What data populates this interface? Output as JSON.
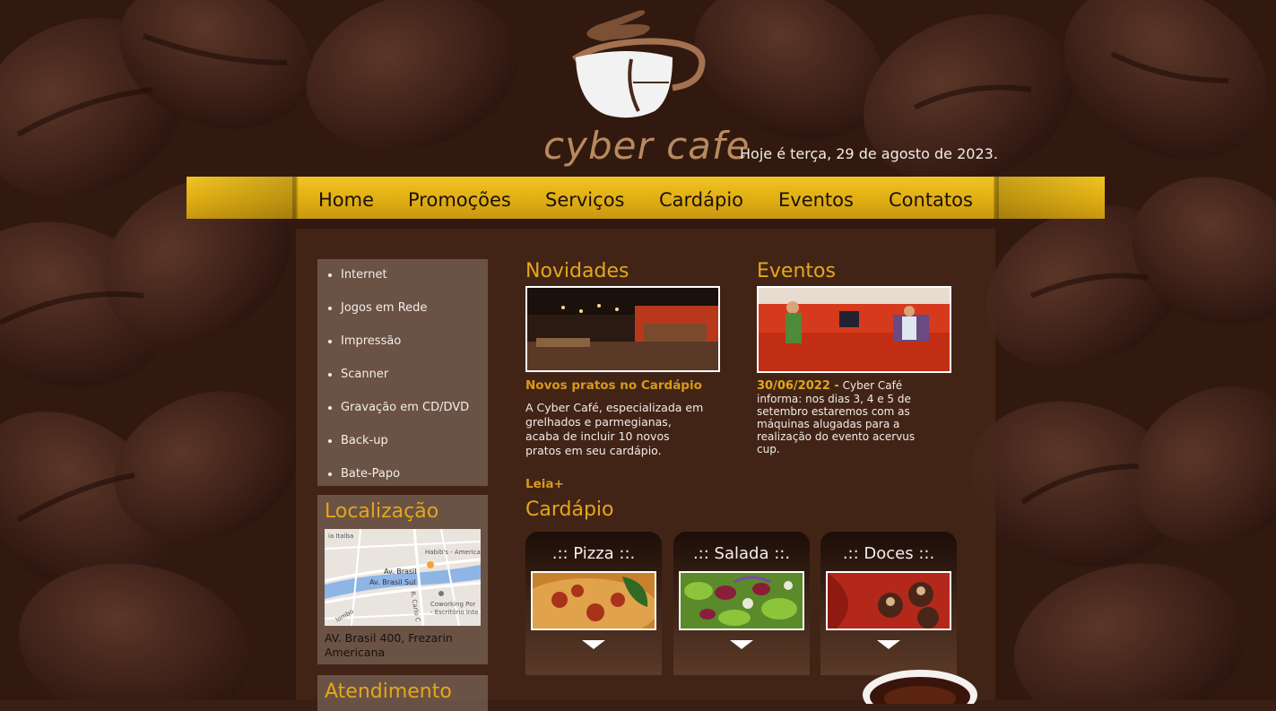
{
  "brand": {
    "name": "cyber cafe"
  },
  "header": {
    "date_text": "Hoje é terça, 29 de agosto de 2023."
  },
  "nav": {
    "items": [
      {
        "label": "Home"
      },
      {
        "label": "Promoções"
      },
      {
        "label": "Serviços"
      },
      {
        "label": "Cardápio"
      },
      {
        "label": "Eventos"
      },
      {
        "label": "Contatos"
      }
    ]
  },
  "sidebar": {
    "services": [
      {
        "label": "Internet"
      },
      {
        "label": "Jogos em Rede"
      },
      {
        "label": "Impressão"
      },
      {
        "label": "Scanner"
      },
      {
        "label": "Gravação em CD/DVD"
      },
      {
        "label": "Back-up"
      },
      {
        "label": "Bate-Papo"
      }
    ],
    "location": {
      "title": "Localização",
      "address": "AV. Brasil 400, Frezarin Americana",
      "map_labels": [
        "ia Itaiba",
        "Habib's - America",
        "Av. Brasil",
        "Av. Brasil Sul",
        "R. Carlo C",
        "Coworking Por",
        "- Escritório Inte",
        "lombo"
      ]
    },
    "attendance": {
      "title": "Atendimento"
    }
  },
  "news": {
    "title": "Novidades",
    "headline": "Novos pratos no Cardápio",
    "body": "A Cyber Café, especializada em grelhados e parmegianas, acaba de incluir 10 novos pratos em seu cardápio.",
    "read_more": "Leia+"
  },
  "events": {
    "title": "Eventos",
    "date": "30/06/2022 -",
    "body": "Cyber Café informa: nos dias 3, 4 e 5 de setembro estaremos com as máquinas alugadas para a realização do evento acervus cup."
  },
  "menu": {
    "title": "Cardápio",
    "cards": [
      {
        "label": ".:: Pizza ::."
      },
      {
        "label": ".:: Salada ::."
      },
      {
        "label": ".:: Doces ::."
      }
    ]
  },
  "colors": {
    "accent": "#e4a71b",
    "nav_bar": "#e8b81a",
    "background": "#3a1f15"
  }
}
